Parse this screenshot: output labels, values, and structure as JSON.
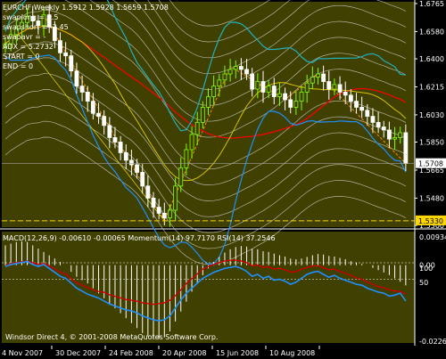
{
  "header": {
    "symbol_line": "EURCHF,Weekly  1.5912 1.5928 1.5659 1.5708",
    "info_lines": [
      "swaplong = 0.5",
      "swapshort = -2.45",
      "swapavr = -",
      "ADX = 5.2732",
      "START = 0",
      "END = 0"
    ]
  },
  "price_axis": {
    "ticks": [
      "1.6765",
      "1.6580",
      "1.6400",
      "1.6215",
      "1.6030",
      "1.5850",
      "1.5665",
      "1.5480",
      "1.5300"
    ],
    "current_price": "1.5708",
    "level_price": "1.5330"
  },
  "indicator": {
    "title": "MACD(12,26,9) -0.00610 -0.00065  Momentum(14) 97.7170  RSI(14) 37.2546",
    "axis_ticks": [
      "0.00934",
      "0.00",
      "100",
      "50",
      "-0.02269"
    ],
    "copyright": "Windsor Direct 4, © 2001-2008 MetaQuotes Software Corp."
  },
  "time_axis": {
    "labels": [
      "4 Nov 2007",
      "30 Dec 2007",
      "24 Feb 2008",
      "20 Apr 2008",
      "15 Jun 2008",
      "10 Aug 2008"
    ]
  },
  "colors": {
    "background": "#000000",
    "main_bg": "#404000",
    "bull": "#7fff00",
    "bear": "#ffffff",
    "env": "#d8d8d8",
    "ma_red": "#ff0000",
    "ma_yellow": "#d4c400",
    "boll": "#1e90ff",
    "boll_mid": "#20b0c0",
    "zigzag": "#ff8c00",
    "level_line": "#ffd700",
    "macd_hist": "#ffffff",
    "signal": "#cc0000",
    "rsi": "#2090ff"
  },
  "chart_data": [
    {
      "type": "candlestick",
      "title": "EURCHF,Weekly",
      "open": 1.5912,
      "high": 1.5928,
      "low": 1.5659,
      "close": 1.5708,
      "ylim": [
        1.53,
        1.6765
      ],
      "y_ticks": [
        1.6765,
        1.658,
        1.64,
        1.6215,
        1.603,
        1.585,
        1.5665,
        1.548,
        1.53
      ],
      "x_labels": [
        "4 Nov 2007",
        "30 Dec 2007",
        "24 Feb 2008",
        "20 Apr 2008",
        "15 Jun 2008",
        "10 Aug 2008"
      ],
      "current_price": 1.5708,
      "horizontal_level": 1.533,
      "series": [
        {
          "name": "close",
          "values": [
            1.65,
            1.656,
            1.66,
            1.664,
            1.668,
            1.665,
            1.662,
            1.669,
            1.661,
            1.652,
            1.644,
            1.642,
            1.632,
            1.622,
            1.618,
            1.612,
            1.604,
            1.602,
            1.596,
            1.588,
            1.585,
            1.578,
            1.573,
            1.57,
            1.565,
            1.556,
            1.548,
            1.542,
            1.538,
            1.535,
            1.54,
            1.556,
            1.568,
            1.58,
            1.59,
            1.598,
            1.608,
            1.615,
            1.622,
            1.626,
            1.63,
            1.633,
            1.635,
            1.633,
            1.63,
            1.62,
            1.625,
            1.618,
            1.622,
            1.615,
            1.617,
            1.613,
            1.608,
            1.612,
            1.618,
            1.624,
            1.628,
            1.63,
            1.625,
            1.62,
            1.623,
            1.618,
            1.616,
            1.612,
            1.608,
            1.606,
            1.602,
            1.598,
            1.595,
            1.593,
            1.587,
            1.588,
            1.5912,
            1.5708
          ]
        }
      ]
    },
    {
      "type": "line",
      "title": "MACD(12,26,9) -0.00610 -0.00065  Momentum(14) 97.7170  RSI(14) 37.2546",
      "x_labels": [
        "4 Nov 2007",
        "30 Dec 2007",
        "24 Feb 2008",
        "20 Apr 2008",
        "15 Jun 2008",
        "10 Aug 2008"
      ],
      "ylim": [
        -0.02269,
        0.00934
      ],
      "series": [
        {
          "name": "MACD(12,26,9)",
          "values": [
            0.006,
            0.0065,
            0.007,
            0.0072,
            0.007,
            0.006,
            0.005,
            0.004,
            0.003,
            0.002,
            0.001,
            0.0,
            -0.002,
            -0.0035,
            -0.0045,
            -0.0055,
            -0.007,
            -0.0085,
            -0.01,
            -0.0115,
            -0.013,
            -0.0145,
            -0.016,
            -0.0175,
            -0.019,
            -0.0205,
            -0.0215,
            -0.022,
            -0.0222,
            -0.0218,
            -0.02,
            -0.017,
            -0.014,
            -0.011,
            -0.008,
            -0.0055,
            -0.003,
            -0.001,
            0.001,
            0.0025,
            0.0038,
            0.0048,
            0.0055,
            0.0058,
            0.0056,
            0.005,
            0.0048,
            0.0042,
            0.004,
            0.0035,
            0.003,
            0.0026,
            0.002,
            0.0018,
            0.002,
            0.0025,
            0.003,
            0.0034,
            0.0032,
            0.0028,
            0.0026,
            0.0022,
            0.0018,
            0.0012,
            0.0008,
            0.0004,
            0.0,
            -0.0008,
            -0.0015,
            -0.0022,
            -0.003,
            -0.004,
            -0.005,
            -0.0061
          ]
        },
        {
          "name": "Momentum(14)",
          "values": [
            101.2,
            101.5,
            101.6,
            101.7,
            101.8,
            101.6,
            101.4,
            101.5,
            101.2,
            100.8,
            100.4,
            100.2,
            99.6,
            99.1,
            98.8,
            98.5,
            98.2,
            98.0,
            97.9,
            97.6,
            97.4,
            97.2,
            97.0,
            96.9,
            96.8,
            96.6,
            96.5,
            96.4,
            96.5,
            96.6,
            96.9,
            97.5,
            98.2,
            99.0,
            99.6,
            100.2,
            100.8,
            101.1,
            101.4,
            101.6,
            101.8,
            101.9,
            101.9,
            101.8,
            101.6,
            101.2,
            101.3,
            101.0,
            101.1,
            100.8,
            100.9,
            100.7,
            100.4,
            100.5,
            100.8,
            101.0,
            101.2,
            101.2,
            101.0,
            100.7,
            100.8,
            100.5,
            100.3,
            100.0,
            99.7,
            99.5,
            99.2,
            98.9,
            98.6,
            98.5,
            98.2,
            98.1,
            98.0,
            97.7
          ]
        },
        {
          "name": "RSI(14)",
          "values": [
            72,
            74,
            75,
            76,
            77,
            74,
            72,
            74,
            70,
            66,
            62,
            60,
            55,
            50,
            47,
            44,
            42,
            40,
            37,
            34,
            32,
            30,
            28,
            27,
            25,
            22,
            20,
            18,
            17,
            18,
            22,
            30,
            38,
            45,
            50,
            55,
            60,
            63,
            66,
            68,
            70,
            71,
            72,
            70,
            67,
            62,
            64,
            60,
            62,
            58,
            59,
            57,
            54,
            56,
            60,
            64,
            66,
            67,
            64,
            61,
            63,
            60,
            58,
            56,
            54,
            53,
            50,
            48,
            46,
            45,
            42,
            43,
            45,
            37
          ]
        }
      ]
    }
  ]
}
